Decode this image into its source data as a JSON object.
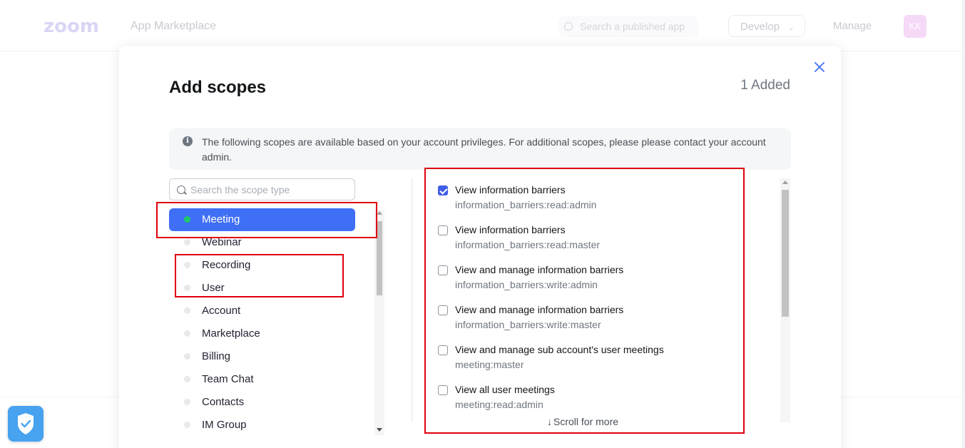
{
  "background": {
    "logo": "zoom",
    "marketplace_label": "App Marketplace",
    "search_placeholder": "Search a published app",
    "develop_label": "Develop",
    "manage_label": "Manage",
    "avatar_initials": "KK"
  },
  "modal": {
    "title": "Add scopes",
    "added_count": "1 Added",
    "notice": "The following scopes are available based on your account privileges. For additional scopes, please please contact your account admin.",
    "search_placeholder": "Search the scope type",
    "categories": [
      {
        "label": "Meeting",
        "active": true
      },
      {
        "label": "Webinar",
        "active": false
      },
      {
        "label": "Recording",
        "active": false
      },
      {
        "label": "User",
        "active": false
      },
      {
        "label": "Account",
        "active": false
      },
      {
        "label": "Marketplace",
        "active": false
      },
      {
        "label": "Billing",
        "active": false
      },
      {
        "label": "Team Chat",
        "active": false
      },
      {
        "label": "Contacts",
        "active": false
      },
      {
        "label": "IM Group",
        "active": false
      }
    ],
    "scopes": [
      {
        "name": "View information barriers",
        "id": "information_barriers:read:admin",
        "checked": true
      },
      {
        "name": "View information barriers",
        "id": "information_barriers:read:master",
        "checked": false
      },
      {
        "name": "View and manage information barriers",
        "id": "information_barriers:write:admin",
        "checked": false
      },
      {
        "name": "View and manage information barriers",
        "id": "information_barriers:write:master",
        "checked": false
      },
      {
        "name": "View and manage sub account's user meetings",
        "id": "meeting:master",
        "checked": false
      },
      {
        "name": "View all user meetings",
        "id": "meeting:read:admin",
        "checked": false
      }
    ],
    "scroll_hint": "Scroll for more"
  },
  "colors": {
    "accent": "#3f6ff5",
    "active_dot": "#1ec96a",
    "highlight": "#e0000e",
    "checkbox_checked": "#3f5ee6"
  }
}
